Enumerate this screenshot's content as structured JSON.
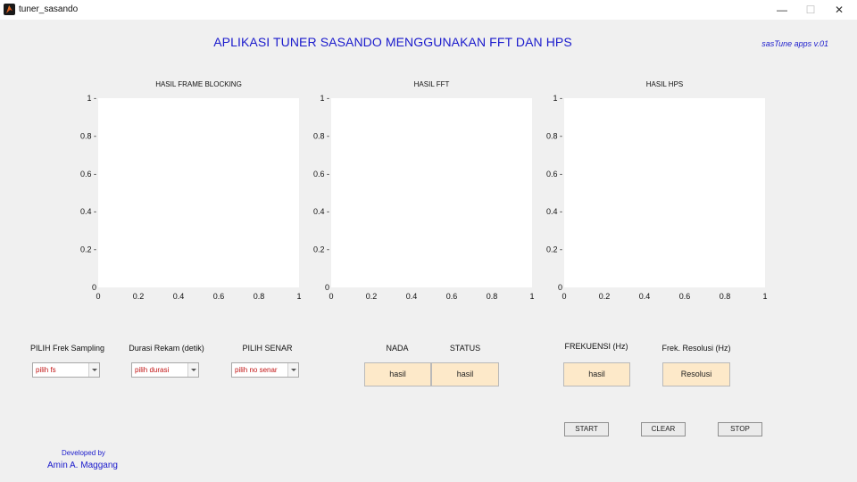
{
  "window": {
    "title": "tuner_sasando",
    "minimize": "—",
    "maximize": "☐",
    "close": "✕"
  },
  "header": {
    "title": "APLIKASI TUNER SASANDO MENGGUNAKAN FFT DAN HPS",
    "version": "sasTune apps v.01"
  },
  "chart_data": [
    {
      "type": "line",
      "title": "HASIL FRAME BLOCKING",
      "xlim": [
        0,
        1
      ],
      "ylim": [
        0,
        1
      ],
      "xticks": [
        "0",
        "0.2",
        "0.4",
        "0.6",
        "0.8",
        "1"
      ],
      "yticks": [
        "0",
        "0.2 -",
        "0.4 -",
        "0.6 -",
        "0.8 -",
        "1 -"
      ],
      "series": []
    },
    {
      "type": "line",
      "title": "HASIL FFT",
      "xlim": [
        0,
        1
      ],
      "ylim": [
        0,
        1
      ],
      "xticks": [
        "0",
        "0.2",
        "0.4",
        "0.6",
        "0.8",
        "1"
      ],
      "yticks": [
        "0",
        "0.2 -",
        "0.4 -",
        "0.6 -",
        "0.8 -",
        "1 -"
      ],
      "series": []
    },
    {
      "type": "line",
      "title": "HASIL HPS",
      "xlim": [
        0,
        1
      ],
      "ylim": [
        0,
        1
      ],
      "xticks": [
        "0",
        "0.2",
        "0.4",
        "0.6",
        "0.8",
        "1"
      ],
      "yticks": [
        "0",
        "0.2 -",
        "0.4 -",
        "0.6 -",
        "0.8 -",
        "1 -"
      ],
      "series": []
    }
  ],
  "controls": {
    "sampling_label": "PILIH Frek Sampling",
    "sampling_value": "pilih fs",
    "duration_label": "Durasi Rekam (detik)",
    "duration_value": "pilih durasi",
    "string_label": "PILIH SENAR",
    "string_value": "pilih no senar"
  },
  "results": {
    "nada_label": "NADA",
    "nada_value": "hasil",
    "status_label": "STATUS",
    "status_value": "hasil",
    "frekuensi_label": "FREKUENSI (Hz)",
    "frekuensi_value": "hasil",
    "resolusi_label": "Frek. Resolusi (Hz)",
    "resolusi_value": "Resolusi"
  },
  "buttons": {
    "start": "START",
    "clear": "CLEAR",
    "stop": "STOP"
  },
  "footer": {
    "developed_by": "Developed by",
    "author": "Amin A. Maggang"
  }
}
